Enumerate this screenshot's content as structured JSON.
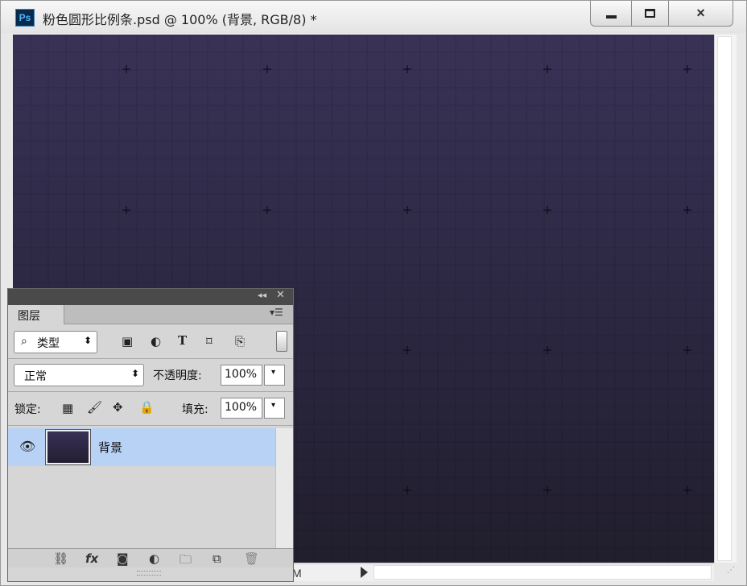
{
  "window": {
    "app_logo": "Ps",
    "title": "粉色圆形比例条.psd @ 100% (背景, RGB/8) *",
    "controls": {
      "minimize": "minimize-icon",
      "maximize": "maximize-icon",
      "close": "×"
    }
  },
  "canvas": {
    "gradient_top": "#393256",
    "gradient_bottom": "#211e2d"
  },
  "status": {
    "zoom_fragment": "M"
  },
  "layers_panel": {
    "tab_label": "图层",
    "filter": {
      "label": "类型",
      "icons": [
        "image-filter-icon",
        "adjustment-filter-icon",
        "type-filter-icon",
        "shape-filter-icon",
        "smart-object-filter-icon"
      ],
      "type_glyph": "T"
    },
    "blend_mode": "正常",
    "opacity_label": "不透明度:",
    "opacity_value": "100%",
    "lock_label": "锁定:",
    "fill_label": "填充:",
    "fill_value": "100%",
    "layers": [
      {
        "name": "背景",
        "visible": true,
        "selected": true
      }
    ],
    "footer_icons": [
      "link-icon",
      "fx-icon",
      "mask-icon",
      "adjustment-icon",
      "folder-icon",
      "new-layer-icon",
      "trash-icon"
    ],
    "fx_label": "fx"
  }
}
